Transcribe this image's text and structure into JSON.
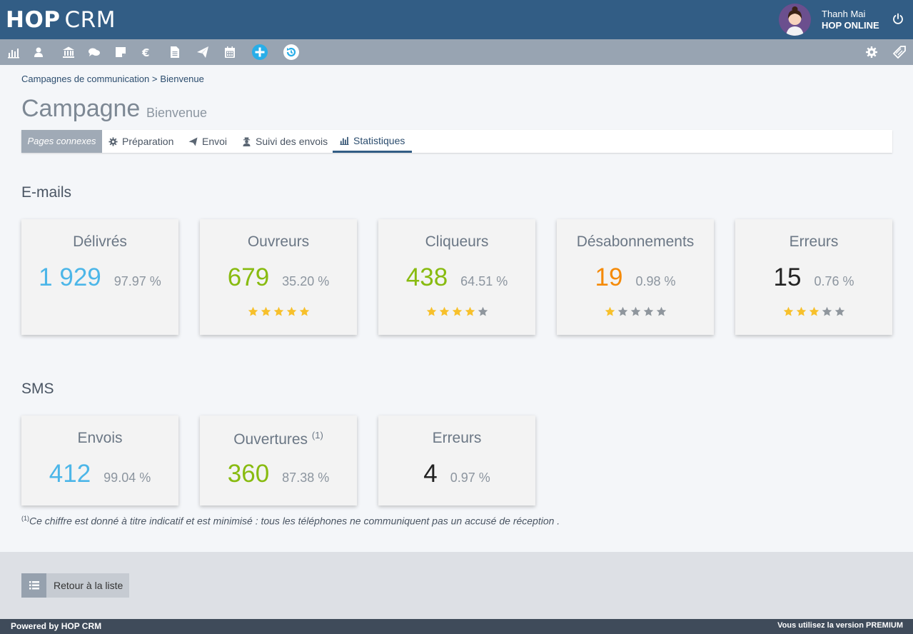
{
  "header": {
    "logo_hop": "HOP",
    "logo_crm": "CRM",
    "user_name": "Thanh Mai",
    "company": "HOP ONLINE"
  },
  "toolbar": {
    "icons": [
      "chart-icon",
      "user-icon",
      "bank-icon",
      "chat-icon",
      "note-icon",
      "euro-icon",
      "document-icon",
      "send-icon",
      "calendar-icon",
      "add-icon",
      "history-icon",
      "settings-icon",
      "tag-icon"
    ]
  },
  "breadcrumb": {
    "parent": "Campagnes de communication >",
    "current": "Bienvenue"
  },
  "page": {
    "title": "Campagne",
    "subtitle": "Bienvenue"
  },
  "tabs": {
    "label": "Pages connexes",
    "items": [
      "Préparation",
      "Envoi",
      "Suivi des envois",
      "Statistiques"
    ],
    "active": "Statistiques"
  },
  "emails": {
    "title": "E-mails",
    "cards": [
      {
        "title": "Délivrés",
        "value": "1 929",
        "pct": "97.97 %",
        "color": "#4cb6e8",
        "stars": null
      },
      {
        "title": "Ouvreurs",
        "value": "679",
        "pct": "35.20 %",
        "color": "#88bb10",
        "stars": 5
      },
      {
        "title": "Cliqueurs",
        "value": "438",
        "pct": "64.51 %",
        "color": "#88bb10",
        "stars": 4
      },
      {
        "title": "Désabonnements",
        "value": "19",
        "pct": "0.98 %",
        "color": "#f58a07",
        "stars": 1
      },
      {
        "title": "Erreurs",
        "value": "15",
        "pct": "0.76 %",
        "color": "#222222",
        "stars": 3
      }
    ]
  },
  "sms": {
    "title": "SMS",
    "cards": [
      {
        "title": "Envois",
        "value": "412",
        "pct": "99.04 %",
        "color": "#4cb6e8"
      },
      {
        "title": "Ouvertures",
        "sup": "(1)",
        "value": "360",
        "pct": "87.38 %",
        "color": "#88bb10"
      },
      {
        "title": "Erreurs",
        "value": "4",
        "pct": "0.97 %",
        "color": "#222222"
      }
    ]
  },
  "footnote": {
    "sup": "(1)",
    "text": "Ce chiffre est donné à titre indicatif et est minimisé : tous les téléphones ne communiquent pas un accusé de réception ."
  },
  "back_button": "Retour à la liste",
  "footer": {
    "left": "Powered by HOP CRM",
    "right": "Vous utilisez la version PREMIUM"
  },
  "colors": {
    "header_bg": "#325d85",
    "toolbar_bg": "#98a4b2",
    "star_on": "#f7c02b",
    "star_off": "#8f969d"
  }
}
